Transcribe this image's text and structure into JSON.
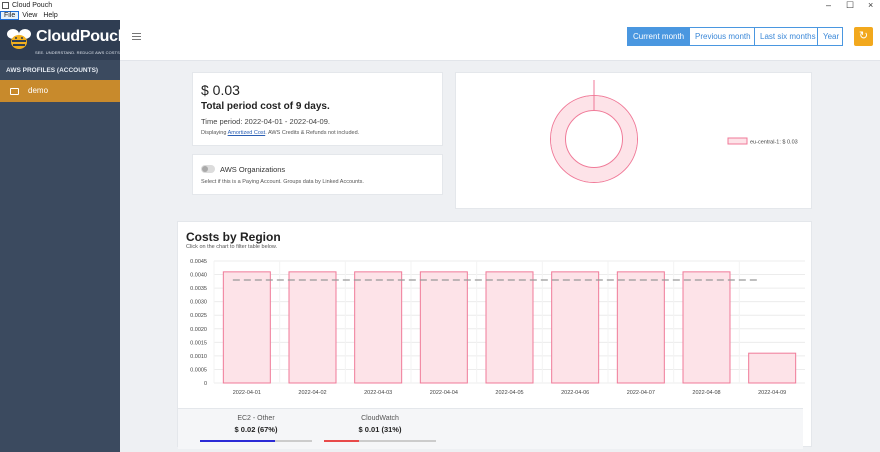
{
  "window": {
    "title": "Cloud Pouch",
    "minimize": "–",
    "maximize": "☐",
    "close": "×"
  },
  "menu": {
    "file": "File",
    "view": "View",
    "help": "Help"
  },
  "sidebar": {
    "brand": "CloudPouch",
    "tagline": "SEE. UNDERSTAND. REDUCE AWS COSTS",
    "section_label": "AWS PROFILES (ACCOUNTS)",
    "items": [
      {
        "label": "demo"
      }
    ]
  },
  "toolbar": {
    "periods": [
      "Current month",
      "Previous month",
      "Last six months",
      "Year"
    ],
    "active_period": "Current month",
    "refresh_icon": "refresh-icon",
    "menu_icon": "hamburger-icon"
  },
  "summary": {
    "cost": "$ 0.03",
    "title": "Total period cost of 9 days.",
    "period": "Time period: 2022-04-01 - 2022-04-09.",
    "display_prefix": "Displaying ",
    "display_link": "Amortized Cost",
    "display_suffix": ". AWS Credits & Refunds not included."
  },
  "organizations": {
    "label": "AWS Organizations",
    "enabled": false,
    "description": "Select if this is a Paying Account. Groups data by Linked Accounts."
  },
  "donut": {
    "legend": "eu-central-1: $ 0.03",
    "slices": [
      {
        "region": "eu-central-1",
        "share": 1.0
      }
    ],
    "fill": "#fde3e8",
    "stroke": "#f07a98"
  },
  "region_chart": {
    "title": "Costs by Region",
    "subtitle": "Click on the chart to filter table below."
  },
  "services": [
    {
      "name": "EC2 - Other",
      "value": "$ 0.02 (67%)",
      "share": 0.67,
      "color": "#2b2bd6"
    },
    {
      "name": "CloudWatch",
      "value": "$ 0.01 (31%)",
      "share": 0.31,
      "color": "#e84a4a"
    }
  ],
  "chart_data": {
    "type": "bar",
    "categories": [
      "2022-04-01",
      "2022-04-02",
      "2022-04-03",
      "2022-04-04",
      "2022-04-05",
      "2022-04-06",
      "2022-04-07",
      "2022-04-08",
      "2022-04-09"
    ],
    "series": [
      {
        "values": [
          0.0041,
          0.0041,
          0.0041,
          0.0041,
          0.0041,
          0.0041,
          0.0041,
          0.0041,
          0.0011
        ]
      }
    ],
    "average": 0.0038,
    "yticks": [
      "0",
      "0.0005",
      "0.0010",
      "0.0015",
      "0.0020",
      "0.0025",
      "0.0030",
      "0.0035",
      "0.0040",
      "0.0045"
    ],
    "ylim": [
      0,
      0.0045
    ],
    "grid": true,
    "bar_fill": "#fde3e8",
    "bar_stroke": "#f07a98"
  }
}
